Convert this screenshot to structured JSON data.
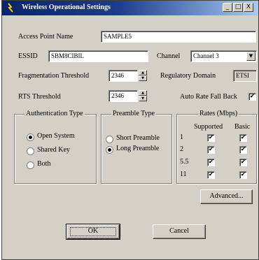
{
  "window": {
    "title": "Wireless Operational Settings",
    "controls": [
      "_",
      "□",
      "X"
    ]
  },
  "ap_name": {
    "label": "Access Point Name",
    "value": "SAMPLE5"
  },
  "essid": {
    "label": "ESSID",
    "value": "SBM8CIBIL"
  },
  "channel": {
    "label": "Channel",
    "value": "Channel 3"
  },
  "fragmentation": {
    "label": "Fragmentation Threshold",
    "value": "2346"
  },
  "regulatory": {
    "label": "Regulatory Domain",
    "value": "ETSI"
  },
  "rts": {
    "label": "RTS Threshold",
    "value": "2346"
  },
  "auto_rate": {
    "label": "Auto Rate Fall Back",
    "checked": true
  },
  "auth": {
    "title": "Authentication Type",
    "options": [
      {
        "label": "Open System",
        "selected": true
      },
      {
        "label": "Shared Key",
        "selected": false
      },
      {
        "label": "Both",
        "selected": false
      }
    ]
  },
  "preamble": {
    "title": "Preamble Type",
    "options": [
      {
        "label": "Short Preamble",
        "selected": false
      },
      {
        "label": "Long Preamble",
        "selected": true
      }
    ]
  },
  "rates": {
    "title": "Rates (Mbps)",
    "col_supported": "Supported",
    "col_basic": "Basic",
    "rows": [
      {
        "rate": "1",
        "supported": true,
        "basic": true
      },
      {
        "rate": "2",
        "supported": true,
        "basic": true
      },
      {
        "rate": "5.5",
        "supported": true,
        "basic": true
      },
      {
        "rate": "11",
        "supported": true,
        "basic": true
      }
    ]
  },
  "buttons": {
    "advanced": "Advanced...",
    "ok": "OK",
    "cancel": "Cancel"
  },
  "check_glyph": "✔"
}
